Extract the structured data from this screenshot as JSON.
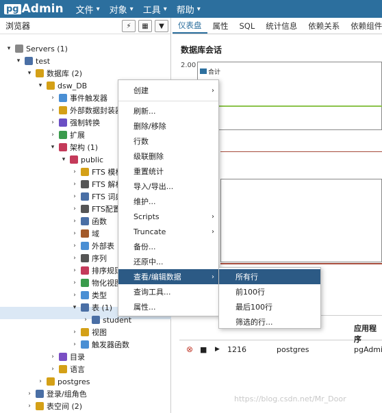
{
  "app": {
    "logo_prefix": "pg",
    "logo_suffix": "Admin"
  },
  "menubar": {
    "items": [
      "文件",
      "对象",
      "工具",
      "帮助"
    ]
  },
  "browser": {
    "title": "浏览器"
  },
  "tabs": [
    "仪表盘",
    "属性",
    "SQL",
    "统计信息",
    "依赖关系",
    "依赖组件"
  ],
  "dashboard": {
    "section_title": "数据库会话",
    "y_tick": "2.00",
    "legend_item": "合计"
  },
  "tree": [
    {
      "label": "Servers (1)",
      "icon": "server-group-icon"
    },
    {
      "label": "test",
      "icon": "server-icon"
    },
    {
      "label": "数据库 (2)",
      "icon": "databases-icon"
    },
    {
      "label": "dsw_DB",
      "icon": "database-icon"
    },
    {
      "label": "事件触发器",
      "icon": "event-trigger-icon"
    },
    {
      "label": "外部数据封装器",
      "icon": "fdw-icon"
    },
    {
      "label": "强制转换",
      "icon": "cast-icon"
    },
    {
      "label": "扩展",
      "icon": "extension-icon"
    },
    {
      "label": "架构 (1)",
      "icon": "schemas-icon"
    },
    {
      "label": "public",
      "icon": "schema-icon"
    },
    {
      "label": "FTS 模板",
      "icon": "fts-template-icon"
    },
    {
      "label": "FTS 解析",
      "icon": "fts-parser-icon"
    },
    {
      "label": "FTS 词典",
      "icon": "fts-dictionary-icon"
    },
    {
      "label": "FTS配置",
      "icon": "fts-config-icon"
    },
    {
      "label": "函数",
      "icon": "function-icon"
    },
    {
      "label": "域",
      "icon": "domain-icon"
    },
    {
      "label": "外部表",
      "icon": "foreign-table-icon"
    },
    {
      "label": "序列",
      "icon": "sequence-icon"
    },
    {
      "label": "排序规则",
      "icon": "collation-icon"
    },
    {
      "label": "物化视图",
      "icon": "mview-icon"
    },
    {
      "label": "类型",
      "icon": "type-icon"
    },
    {
      "label": "表 (1)",
      "icon": "tables-icon"
    },
    {
      "label": "student",
      "icon": "table-icon"
    },
    {
      "label": "视图",
      "icon": "view-icon"
    },
    {
      "label": "触发器函数",
      "icon": "trigger-function-icon"
    },
    {
      "label": "目录",
      "icon": "catalog-icon"
    },
    {
      "label": "语言",
      "icon": "language-icon"
    },
    {
      "label": "postgres",
      "icon": "database-icon"
    },
    {
      "label": "登录/组角色",
      "icon": "login-role-icon"
    },
    {
      "label": "表空间 (2)",
      "icon": "tablespace-icon"
    }
  ],
  "context_menu": {
    "items": [
      "创建",
      "刷新...",
      "删除/移除",
      "行数",
      "级联删除",
      "重置统计",
      "导入/导出...",
      "维护...",
      "Scripts",
      "Truncate",
      "备份...",
      "还原中...",
      "查看/编辑数据",
      "查询工具...",
      "属性..."
    ],
    "submenu": [
      "所有行",
      "前100行",
      "最后100行",
      "筛选的行..."
    ]
  },
  "sessions_table": {
    "header_app": "应用程序",
    "row": {
      "pid": "1216",
      "user": "postgres",
      "app": "pgAdmi"
    }
  },
  "watermark": "https://blog.csdn.net/Mr_Door",
  "colors": {
    "topbar": "#2c6f9e",
    "highlight": "#2c5a85",
    "selected_row": "#dbe8f5"
  }
}
